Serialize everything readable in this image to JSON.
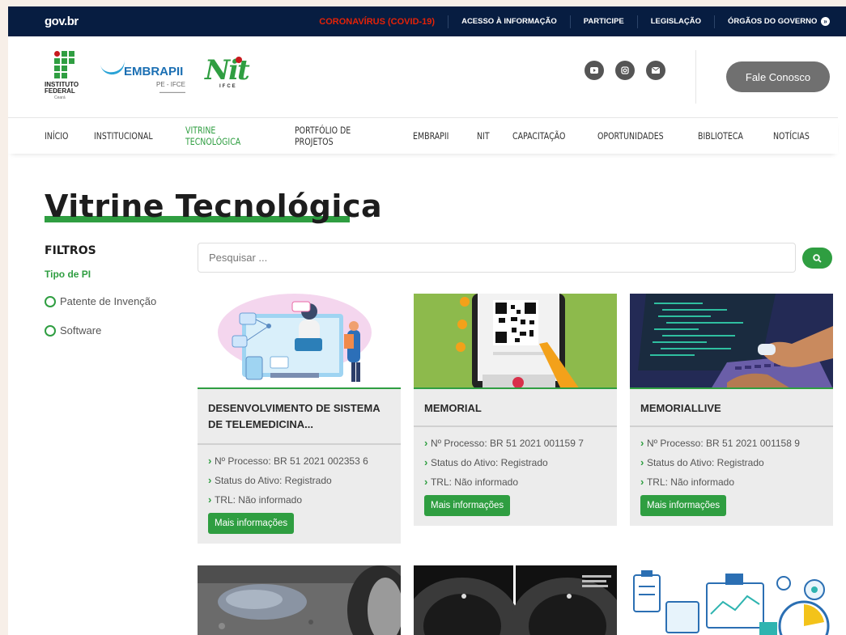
{
  "govbar": {
    "logo": "gov.br",
    "links": [
      "CORONAVÍRUS (COVID-19)",
      "ACESSO À INFORMAÇÃO",
      "PARTICIPE",
      "LEGISLAÇÃO",
      "ÓRGÃOS DO GOVERNO"
    ],
    "chevron": "»"
  },
  "header": {
    "if_name_1": "INSTITUTO",
    "if_name_2": "FEDERAL",
    "if_campus": "Ceará",
    "embrapii_name": "EMBRAPII",
    "embrapii_unit": "PE - IFCE",
    "nit_name": "Nit",
    "nit_sub": "IFCE",
    "social_icons": [
      "youtube-icon",
      "instagram-icon",
      "email-icon"
    ],
    "contact_button": "Fale Conosco"
  },
  "nav": [
    "INÍCIO",
    "INSTITUCIONAL",
    "VITRINE TECNOLÓGICA",
    "PORTFÓLIO DE PROJETOS",
    "EMBRAPII",
    "NIT",
    "CAPACITAÇÃO",
    "OPORTUNIDADES",
    "BIBLIOTECA",
    "NOTÍCIAS"
  ],
  "nav_active": "VITRINE TECNOLÓGICA",
  "page": {
    "title": "Vitrine Tecnológica",
    "filters_title": "FILTROS",
    "filter_group": "Tipo de PI",
    "filter_options": [
      "Patente de Invenção",
      "Software"
    ],
    "search_placeholder": "Pesquisar ..."
  },
  "cards": [
    {
      "title": "DESENVOLVIMENTO DE SISTEMA DE TELEMEDICINA...",
      "processo": "Nº Processo: BR 51 2021 002353 6",
      "status": "Status do Ativo: Registrado",
      "trl": "TRL: Não informado",
      "button": "Mais informações"
    },
    {
      "title": "MEMORIAL",
      "processo": "Nº Processo: BR 51 2021 001159 7",
      "status": "Status do Ativo: Registrado",
      "trl": "TRL: Não informado",
      "button": "Mais informações"
    },
    {
      "title": "MEMORIALLIVE",
      "processo": "Nº Processo: BR 51 2021 001158 9",
      "status": "Status do Ativo: Registrado",
      "trl": "TRL: Não informado",
      "button": "Mais informações"
    }
  ],
  "colors": {
    "govbar": "#071d41",
    "accent_green": "#2f9e41",
    "covid_red": "#e52207"
  }
}
